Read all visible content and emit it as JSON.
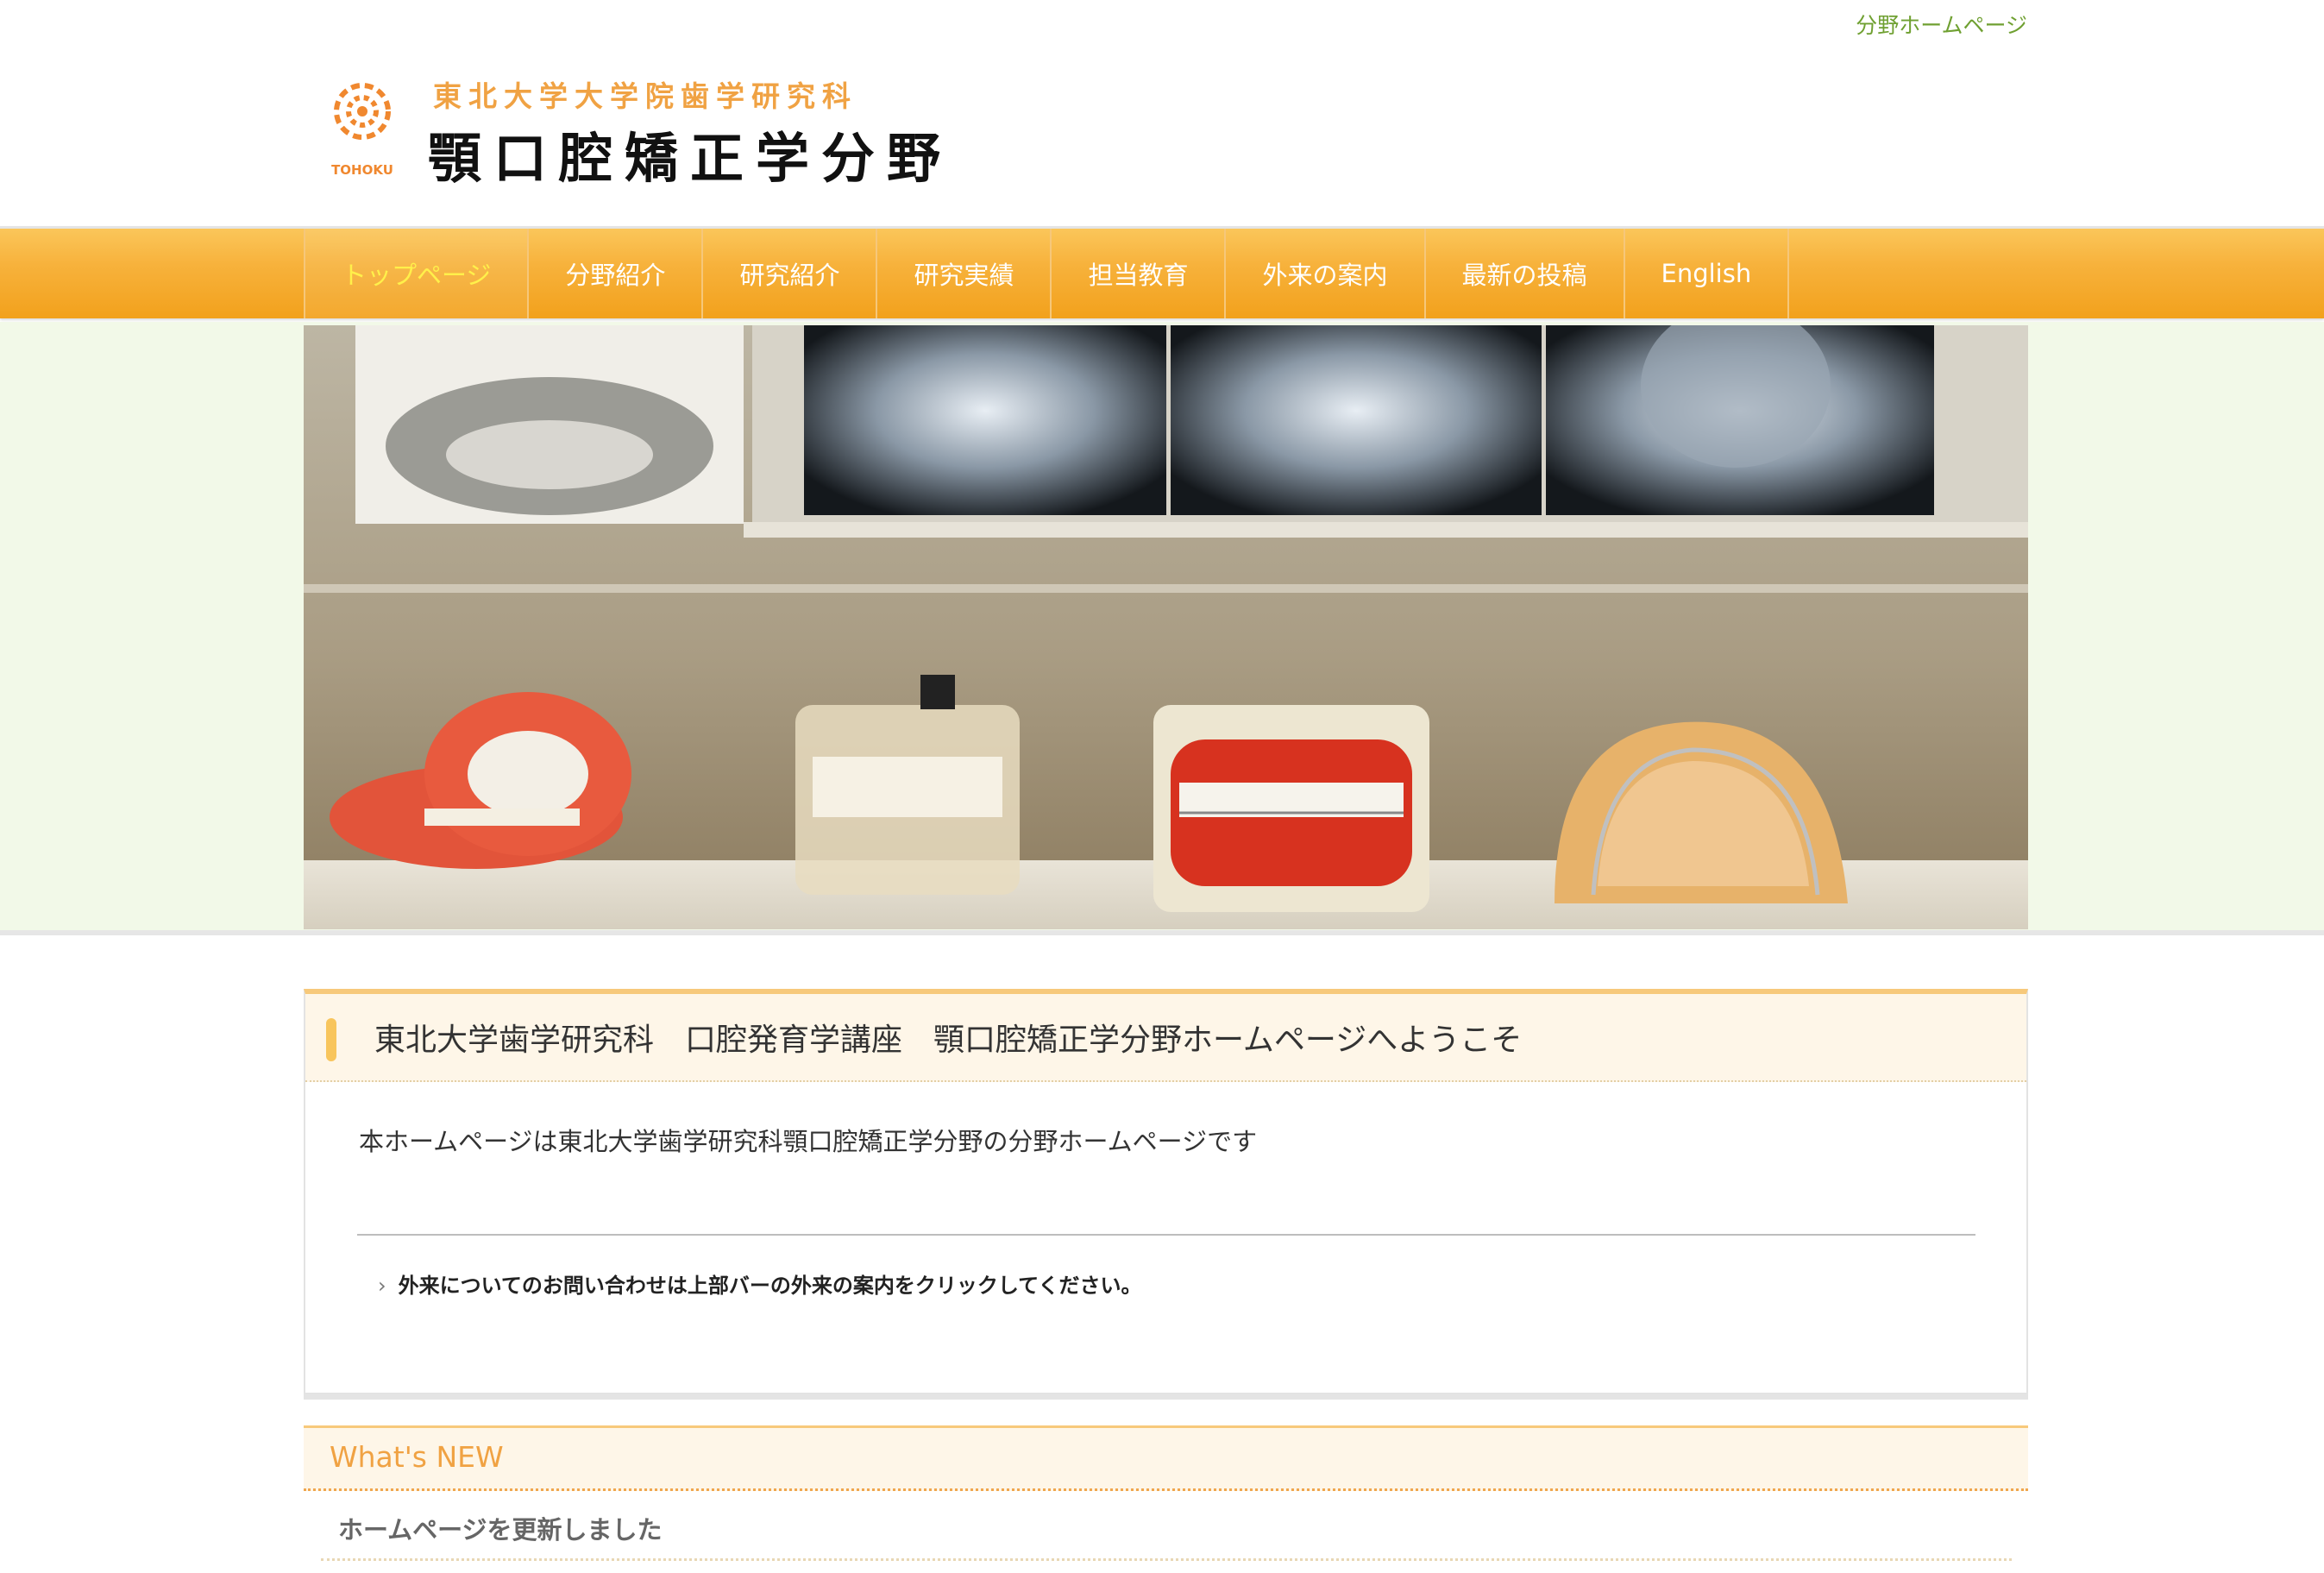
{
  "top_link": "分野ホームページ",
  "logo": {
    "subtitle": "東北大学大学院歯学研究科",
    "title": "顎口腔矯正学分野",
    "mark_text": "TOHOKU"
  },
  "nav": {
    "items": [
      "トップページ",
      "分野紹介",
      "研究紹介",
      "研究実績",
      "担当教育",
      "外来の案内",
      "最新の投稿",
      "English"
    ],
    "active_index": 0
  },
  "welcome": {
    "title": "東北大学歯学研究科　口腔発育学講座　顎口腔矯正学分野ホームページへようこそ",
    "text": "本ホームページは東北大学歯学研究科顎口腔矯正学分野の分野ホームページです",
    "notice_chevron": "›",
    "notice": "外来についてのお問い合わせは上部バーの外来の案内をクリックしてください。"
  },
  "news": {
    "heading": "What's NEW",
    "items": [
      "ホームページを更新しました"
    ]
  },
  "colors": {
    "nav_orange": "#f2a11c",
    "accent_orange": "#f0a243",
    "link_green": "#6fa031",
    "hero_band": "#f2f9e8"
  }
}
